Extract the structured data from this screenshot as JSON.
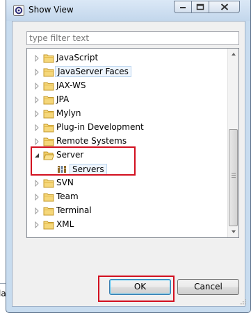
{
  "window": {
    "title": "Show View",
    "controls": [
      "minimize-icon",
      "maximize-icon",
      "close-icon"
    ]
  },
  "filter": {
    "placeholder": "type filter text",
    "value": ""
  },
  "tree": {
    "items": [
      {
        "label": "JavaScript",
        "expanded": false
      },
      {
        "label": "JavaServer Faces",
        "expanded": false,
        "selected": true
      },
      {
        "label": "JAX-WS",
        "expanded": false
      },
      {
        "label": "JPA",
        "expanded": false
      },
      {
        "label": "Mylyn",
        "expanded": false
      },
      {
        "label": "Plug-in Development",
        "expanded": false
      },
      {
        "label": "Remote Systems",
        "expanded": false
      },
      {
        "label": "Server",
        "expanded": true,
        "children": [
          {
            "label": "Servers",
            "icon": "servers-view-icon"
          }
        ]
      },
      {
        "label": "SVN",
        "expanded": false
      },
      {
        "label": "Team",
        "expanded": false
      },
      {
        "label": "Terminal",
        "expanded": false
      },
      {
        "label": "XML",
        "expanded": false
      }
    ]
  },
  "buttons": {
    "ok": "OK",
    "cancel": "Cancel"
  },
  "background": {
    "partial_text": "la"
  },
  "colors": {
    "highlight_box": "#d20f1f",
    "selection_border": "#bcd5ee",
    "folder": "#e8c15a"
  }
}
